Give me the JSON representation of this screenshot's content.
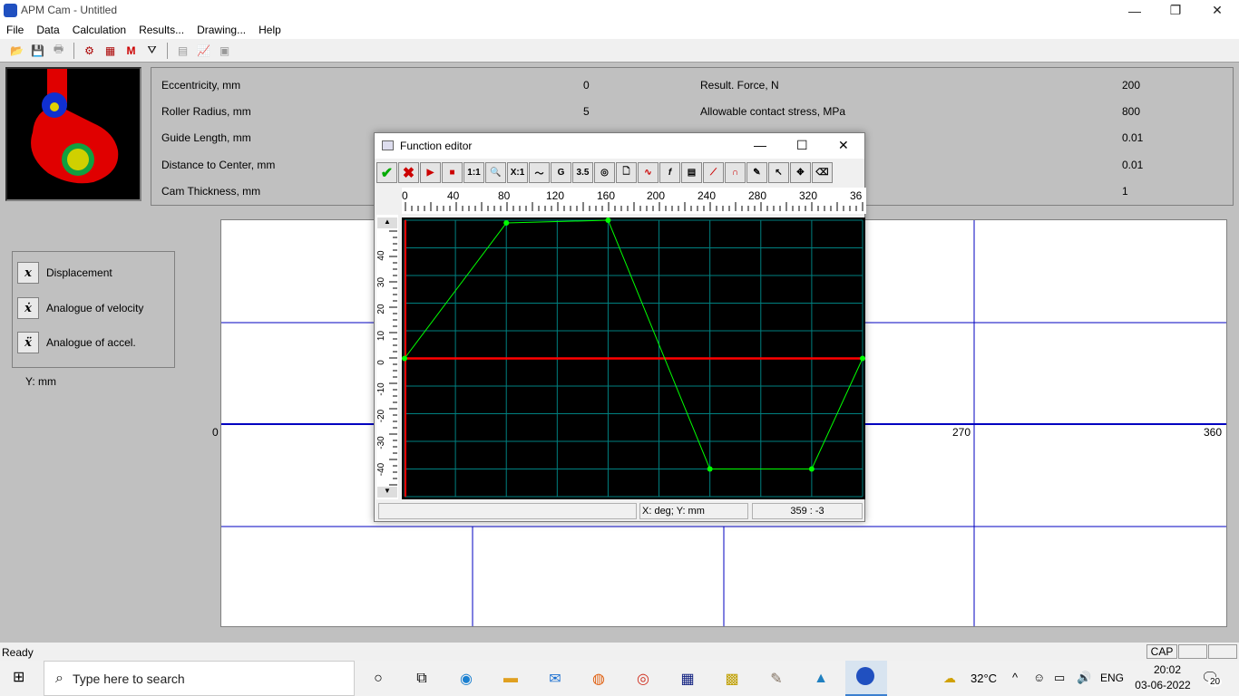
{
  "app": {
    "title": "APM Cam - Untitled"
  },
  "window_controls": {
    "minimize": "—",
    "restore": "❐",
    "close": "✕"
  },
  "menu": [
    "File",
    "Data",
    "Calculation",
    "Results...",
    "Drawing...",
    "Help"
  ],
  "params": {
    "left": [
      {
        "label": "Eccentricity, mm",
        "value": "0"
      },
      {
        "label": "Roller Radius, mm",
        "value": "5"
      },
      {
        "label": "Guide Length, mm",
        "value": ""
      },
      {
        "label": "Distance to Center, mm",
        "value": ""
      },
      {
        "label": "Cam Thickness, mm",
        "value": ""
      }
    ],
    "right": [
      {
        "label": "Result. Force, N",
        "value": "200"
      },
      {
        "label": "Allowable contact stress, MPa",
        "value": "800"
      },
      {
        "label": "",
        "value": "0.01"
      },
      {
        "label": "",
        "value": "0.01"
      },
      {
        "label": "",
        "value": "1"
      }
    ]
  },
  "legend": {
    "items": [
      {
        "icon": "x",
        "label": "Displacement"
      },
      {
        "icon": "ẋ",
        "label": "Analogue of velocity"
      },
      {
        "icon": "ẍ",
        "label": "Analogue of accel."
      }
    ],
    "y_unit": "Y: mm"
  },
  "graph": {
    "x_labels": [
      "0",
      "270",
      "360"
    ]
  },
  "dialog": {
    "title": "Function editor",
    "ruler_labels": [
      "0",
      "40",
      "80",
      "120",
      "160",
      "200",
      "240",
      "280",
      "320",
      "36"
    ],
    "y_labels": [
      "40",
      "30",
      "20",
      "10",
      "0",
      "-10",
      "-20",
      "-30",
      "-40"
    ],
    "status_units": "X: deg;  Y: mm",
    "status_coords": "359 : -3",
    "toolbar_labels": [
      "1:1",
      "X:1",
      "3.5"
    ]
  },
  "chart_data": {
    "type": "line",
    "xlabel": "X: deg",
    "ylabel": "Y: mm",
    "xlim": [
      0,
      360
    ],
    "ylim": [
      -50,
      50
    ],
    "series": [
      {
        "x": [
          0,
          80,
          160,
          240,
          320,
          360
        ],
        "y": [
          0,
          49,
          50,
          -40,
          -40,
          0
        ]
      }
    ],
    "colors": {
      "line": "#00ff00",
      "grid": "#008080",
      "zero": "#ff0000"
    }
  },
  "status": {
    "text": "Ready",
    "caps": "CAP"
  },
  "taskbar": {
    "search_placeholder": "Type here to search",
    "weather": "32°C",
    "lang": "ENG",
    "time": "20:02",
    "date": "03-06-2022",
    "notifications": "20"
  }
}
